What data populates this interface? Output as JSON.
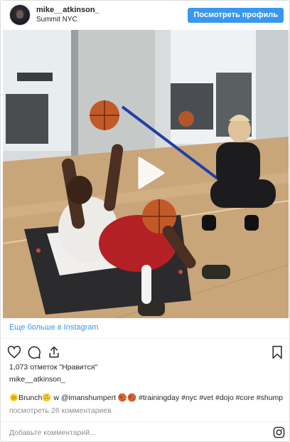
{
  "header": {
    "username": "mike__atkinson_",
    "location": "Summit NYC",
    "profile_button_label": "Посмотреть профиль"
  },
  "media": {
    "type": "video",
    "play_icon": "play-icon"
  },
  "more_link": "Еще больше в Instagram",
  "actions": {
    "like_icon": "heart-icon",
    "comment_icon": "comment-icon",
    "share_icon": "share-icon",
    "save_icon": "bookmark-icon"
  },
  "likes_text": "1,073 отметок \"Нравится\"",
  "caption": {
    "username": "mike__atkinson_",
    "text": "🌞Brunch🙃 w @imanshumpert 🏀🏀 #trainingday #nyc #vet #dojo #core #shump"
  },
  "view_comments": "посмотреть 26 комментариев",
  "comment_input": {
    "placeholder": "Добавьте комментарий..."
  },
  "colors": {
    "accent": "#3897f0",
    "text": "#262626",
    "secondary_text": "#8e8e8e",
    "border": "#dbdbdb"
  }
}
